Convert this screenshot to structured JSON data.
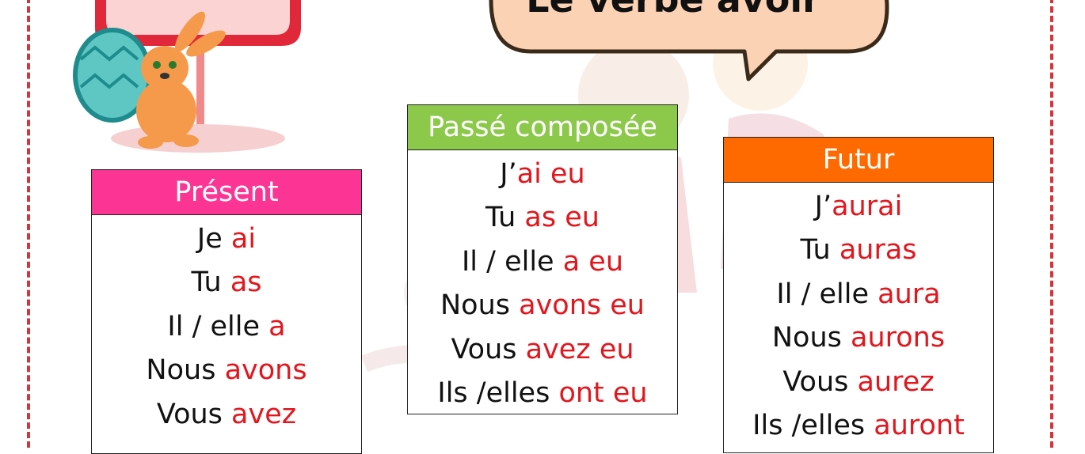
{
  "title": "Le verbe avoir",
  "colors": {
    "border": "#d9333a",
    "verb_text": "#e3161d",
    "present_header": "#fc3595",
    "passe_header": "#8cc94a",
    "futur_header": "#ff6a00"
  },
  "tables": [
    {
      "header": "Présent",
      "rows": [
        {
          "pronoun": "Je ",
          "verb": "ai"
        },
        {
          "pronoun": "Tu ",
          "verb": "as"
        },
        {
          "pronoun": "Il / elle ",
          "verb": "a"
        },
        {
          "pronoun": "Nous ",
          "verb": "avons"
        },
        {
          "pronoun": "Vous ",
          "verb": "avez"
        }
      ]
    },
    {
      "header": "Passé composée",
      "rows": [
        {
          "pronoun": "J’",
          "verb": "ai eu"
        },
        {
          "pronoun": "Tu ",
          "verb": "as eu"
        },
        {
          "pronoun": "Il / elle ",
          "verb": "a eu"
        },
        {
          "pronoun": "Nous ",
          "verb": "avons eu"
        },
        {
          "pronoun": "Vous ",
          "verb": "avez eu"
        },
        {
          "pronoun": "Ils /elles ",
          "verb": "ont eu"
        }
      ]
    },
    {
      "header": "Futur",
      "rows": [
        {
          "pronoun": "J’",
          "verb": "aurai"
        },
        {
          "pronoun": "Tu ",
          "verb": "auras"
        },
        {
          "pronoun": "Il / elle ",
          "verb": "aura"
        },
        {
          "pronoun": "Nous ",
          "verb": "aurons"
        },
        {
          "pronoun": "Vous ",
          "verb": "aurez"
        },
        {
          "pronoun": "Ils /elles ",
          "verb": "auront"
        }
      ]
    }
  ]
}
